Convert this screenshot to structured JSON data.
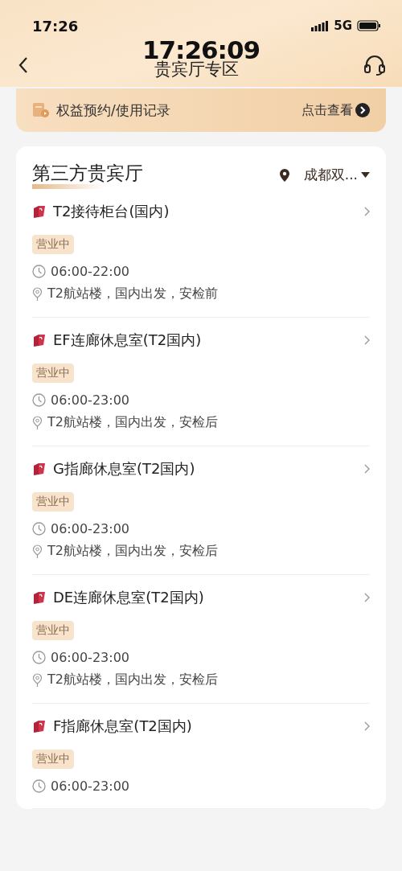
{
  "status_bar": {
    "time": "17:26",
    "network": "5G"
  },
  "clock_overlay": "17:26:09",
  "nav": {
    "title": "贵宾厅专区"
  },
  "banner": {
    "label": "权益预约/使用记录",
    "action": "点击查看"
  },
  "section": {
    "title": "第三方贵宾厅",
    "location": "成都双..."
  },
  "lounges": [
    {
      "name": "T2接待柜台(国内)",
      "status": "营业中",
      "hours": "06:00-22:00",
      "address": "T2航站楼，国内出发，安检前"
    },
    {
      "name": "EF连廊休息室(T2国内)",
      "status": "营业中",
      "hours": "06:00-23:00",
      "address": "T2航站楼，国内出发，安检后"
    },
    {
      "name": "G指廊休息室(T2国内)",
      "status": "营业中",
      "hours": "06:00-23:00",
      "address": "T2航站楼，国内出发，安检后"
    },
    {
      "name": "DE连廊休息室(T2国内)",
      "status": "营业中",
      "hours": "06:00-23:00",
      "address": "T2航站楼，国内出发，安检后"
    },
    {
      "name": "F指廊休息室(T2国内)",
      "status": "营业中",
      "hours": "06:00-23:00"
    }
  ]
}
